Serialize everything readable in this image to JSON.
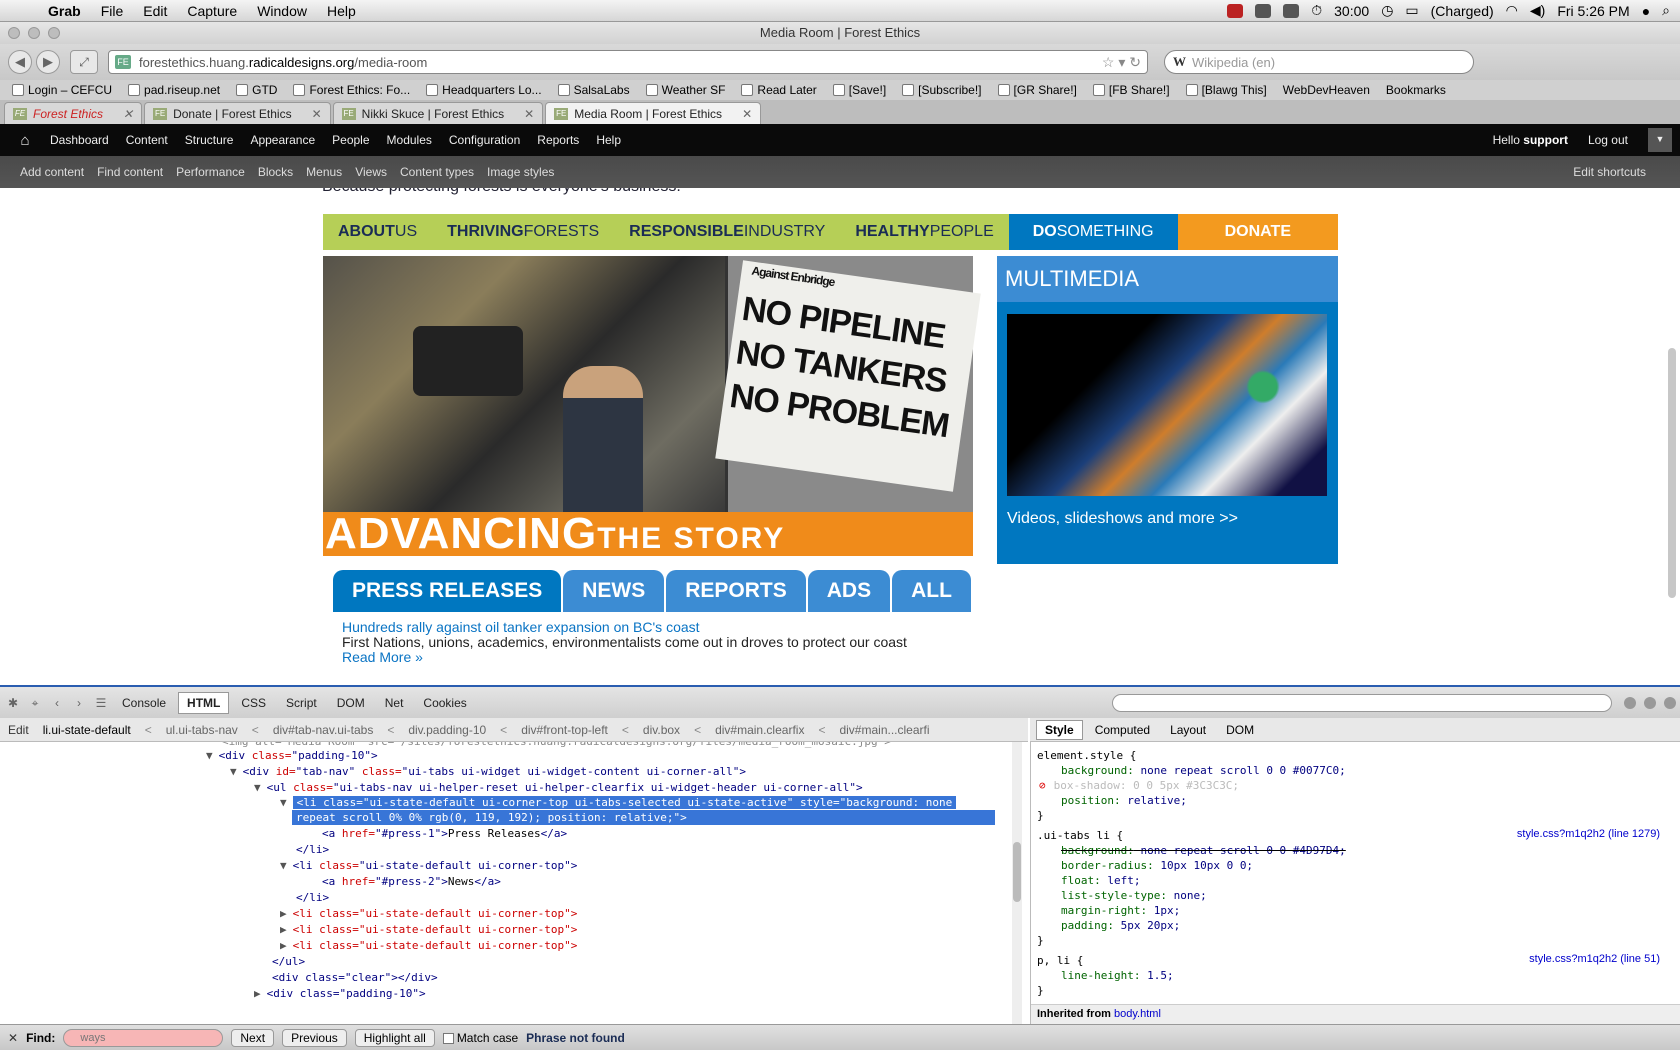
{
  "menubar": {
    "app": "Grab",
    "items": [
      "File",
      "Edit",
      "Capture",
      "Window",
      "Help"
    ],
    "timer": "30:00",
    "battery": "(Charged)",
    "clock": "Fri 5:26 PM"
  },
  "window": {
    "title": "Media Room | Forest Ethics"
  },
  "url": {
    "prefix": "forestethics.huang.",
    "domain": "radicaldesigns.org",
    "path": "/media-room"
  },
  "search": {
    "placeholder": "Wikipedia (en)"
  },
  "bookmarks": [
    "Login – CEFCU",
    "pad.riseup.net",
    "GTD",
    "Forest Ethics: Fo...",
    "Headquarters Lo...",
    "SalsaLabs",
    "Weather SF",
    "Read Later",
    "[Save!]",
    "[Subscribe!]",
    "[GR Share!]",
    "[FB Share!]",
    "[Blawg This]",
    "WebDevHeaven",
    "Bookmarks"
  ],
  "tabs": [
    "Forest Ethics",
    "Donate | Forest Ethics",
    "Nikki Skuce | Forest Ethics",
    "Media Room | Forest Ethics"
  ],
  "admin": {
    "items": [
      "Dashboard",
      "Content",
      "Structure",
      "Appearance",
      "People",
      "Modules",
      "Configuration",
      "Reports",
      "Help"
    ],
    "hello": "Hello",
    "user": "support",
    "logout": "Log out"
  },
  "shortcuts": {
    "items": [
      "Add content",
      "Find content",
      "Performance",
      "Blocks",
      "Menus",
      "Views",
      "Content types",
      "Image styles"
    ],
    "edit": "Edit shortcuts"
  },
  "site": {
    "tagline": "Because protecting forests is everyone's business.",
    "nav": [
      {
        "b": "ABOUT",
        "n": " US"
      },
      {
        "b": "THRIVING",
        "n": " FORESTS"
      },
      {
        "b": "RESPONSIBLE",
        "n": " INDUSTRY"
      },
      {
        "b": "HEALTHY",
        "n": " PEOPLE"
      }
    ],
    "nav_do": {
      "b": "DO",
      "n": " SOMETHING"
    },
    "nav_donate": "DONATE",
    "banner": {
      "top": "Against Enbridge",
      "l1": "NO PIPELINE",
      "l2": "NO TANKERS",
      "l3": "NO PROBLEM"
    },
    "advancing": "ADVANCING",
    "the_story": "THE STORY",
    "multimedia": "MULTIMEDIA",
    "mm_link": "Videos, slideshows and more >>",
    "press_tabs": [
      "PRESS RELEASES",
      "NEWS",
      "REPORTS",
      "ADS",
      "ALL"
    ],
    "article": {
      "title": "Hundreds rally against oil tanker expansion on BC's coast",
      "summary": "First Nations, unions, academics, environmentalists come out in droves to protect our coast",
      "more": "Read More »"
    }
  },
  "firebug": {
    "tabs": [
      "Console",
      "HTML",
      "CSS",
      "Script",
      "DOM",
      "Net",
      "Cookies"
    ],
    "edit": "Edit",
    "crumbs": [
      "li.ui-state-default",
      "ul.ui-tabs-nav",
      "div#tab-nav.ui-tabs",
      "div.padding-10",
      "div#front-top-left",
      "div.box",
      "div#main.clearfix",
      "div#main...clearfi"
    ],
    "side_tabs": [
      "Style",
      "Computed",
      "Layout",
      "DOM"
    ],
    "html": {
      "img_line": "<img alt=\"Media Room\" src=\"/sites/forestethics.huang.radicaldesigns.org/files/media_room_mosaic.jpg\">",
      "l1a": "<div",
      "l1b": " class=",
      "l1c": "\"padding-10\"",
      "l1d": ">",
      "l2a": "<div",
      "l2b": " id=",
      "l2c": "\"tab-nav\"",
      "l2d": " class=",
      "l2e": "\"ui-tabs ui-widget ui-widget-content ui-corner-all\"",
      "l2f": ">",
      "l3a": "<ul",
      "l3b": " class=",
      "l3c": "\"ui-tabs-nav ui-helper-reset ui-helper-clearfix ui-widget-header ui-corner-all\"",
      "l3d": ">",
      "hl1": "<li class=\"ui-state-default ui-corner-top ui-tabs-selected ui-state-active\" style=\"background: none",
      "hl2": "repeat scroll 0% 0% rgb(0, 119, 192); position: relative;\">",
      "a1a": "<a",
      "a1b": " href=",
      "a1c": "\"#press-1\"",
      "a1d": ">",
      "a1e": "Press Releases",
      "a1f": "</a>",
      "li_close": "</li>",
      "li2a": "<li",
      "li2b": " class=",
      "li2c": "\"ui-state-default ui-corner-top\"",
      "li2d": ">",
      "a2a": "<a",
      "a2b": " href=",
      "a2c": "\"#press-2\"",
      "a2d": ">",
      "a2e": "News",
      "a2f": "</a>",
      "li_collapsed": "<li class=\"ui-state-default ui-corner-top\">",
      "ul_close": "</ul>",
      "clear": "<div class=\"clear\"></div>",
      "pad": "<div class=\"padding-10\">"
    },
    "style": {
      "r1": "element.style {",
      "r1a": "background:",
      "r1av": "none repeat scroll 0 0 #0077C0;",
      "r1b": "box-shadow: 0 0 5px #3C3C3C;",
      "r1c": "position:",
      "r1cv": "relative;",
      "close": "}",
      "r2": ".ui-tabs li {",
      "r2src": "style.css?m1q2h2 (line 1279)",
      "r2a": "background:",
      "r2av": "none repeat scroll 0 0 #4D97D4;",
      "r2b": "border-radius:",
      "r2bv": "10px 10px 0 0;",
      "r2c": "float:",
      "r2cv": "left;",
      "r2d": "list-style-type:",
      "r2dv": "none;",
      "r2e": "margin-right:",
      "r2ev": "1px;",
      "r2f": "padding:",
      "r2fv": "5px 20px;",
      "r3": "p, li {",
      "r3src": "style.css?m1q2h2 (line 51)",
      "r3a": "line-height:",
      "r3av": "1.5;",
      "inherited": "Inherited from",
      "inh_el": "body.html"
    },
    "find": {
      "label": "Find:",
      "value": "ways",
      "next": "Next",
      "previous": "Previous",
      "highlight": "Highlight all",
      "match": "Match case",
      "status": "Phrase not found"
    }
  }
}
